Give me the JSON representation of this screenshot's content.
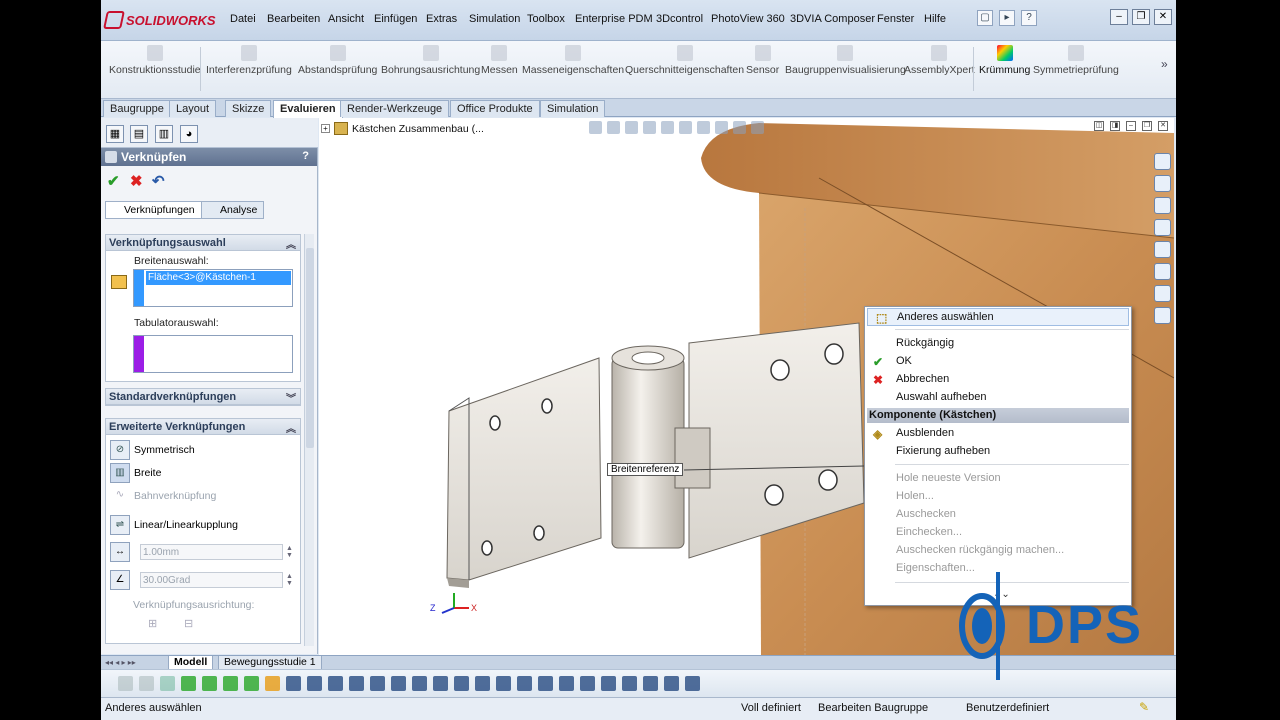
{
  "app": {
    "logo_text": "SOLIDWORKS",
    "accent": "#c8102e"
  },
  "menu": [
    "Datei",
    "Bearbeiten",
    "Ansicht",
    "Einfügen",
    "Extras",
    "Simulation",
    "Toolbox",
    "Enterprise PDM",
    "3Dcontrol",
    "PhotoView 360",
    "3DVIA Composer",
    "Fenster",
    "Hilfe"
  ],
  "commands": [
    "Konstruktionsstudie",
    "Interferenzprüfung",
    "Abstandsprüfung",
    "Bohrungsausrichtung",
    "Messen",
    "Masseneigenschaften",
    "Querschnitteigenschaften",
    "Sensor",
    "Baugruppenvisualisierung",
    "AssemblyXpert",
    "Krümmung",
    "Symmetrieprüfung"
  ],
  "tabs": [
    "Baugruppe",
    "Layout",
    "Skizze",
    "Evaluieren",
    "Render-Werkzeuge",
    "Office Produkte",
    "Simulation"
  ],
  "active_tab": "Evaluieren",
  "property_manager": {
    "title": "Verknüpfen",
    "help": "?",
    "subtabs": [
      "Verknüpfungen",
      "Analyse"
    ],
    "selection_group": {
      "title": "Verknüpfungsauswahl",
      "width_label": "Breitenauswahl:",
      "width_item": "Fläche<3>@Kästchen-1",
      "tab_label": "Tabulatorauswahl:"
    },
    "standard_group": "Standardverknüpfungen",
    "advanced_group": {
      "title": "Erweiterte Verknüpfungen",
      "options": [
        "Symmetrisch",
        "Breite",
        "Bahnverknüpfung",
        "Linear/Linearkupplung"
      ],
      "distance": "1.00mm",
      "angle": "30.00Grad",
      "alignment_label": "Verknüpfungsausrichtung:"
    }
  },
  "feature_tree": {
    "node": "Kästchen Zusammenbau  (..."
  },
  "viewport": {
    "callout": "Breitenreferenz",
    "triad_x": "X",
    "triad_z": "Z"
  },
  "context_menu": {
    "items_top": [
      "Anderes auswählen",
      "Rückgängig",
      "OK",
      "Abbrechen",
      "Auswahl aufheben"
    ],
    "section": "Komponente (Kästchen)",
    "items_mid": [
      "Ausblenden",
      "Fixierung aufheben"
    ],
    "items_disabled": [
      "Hole neueste Version",
      "Holen...",
      "Auschecken",
      "Einchecken...",
      "Auschecken rückgängig machen...",
      "Eigenschaften..."
    ],
    "more": "⌄⌄"
  },
  "bottom_tabs": [
    "Modell",
    "Bewegungsstudie 1"
  ],
  "status": {
    "left": "Anderes auswählen",
    "state": "Voll definiert",
    "mode": "Bearbeiten Baugruppe",
    "units": "Benutzerdefiniert"
  },
  "watermark": {
    "text": "DPS",
    "color": "#1463b8"
  }
}
